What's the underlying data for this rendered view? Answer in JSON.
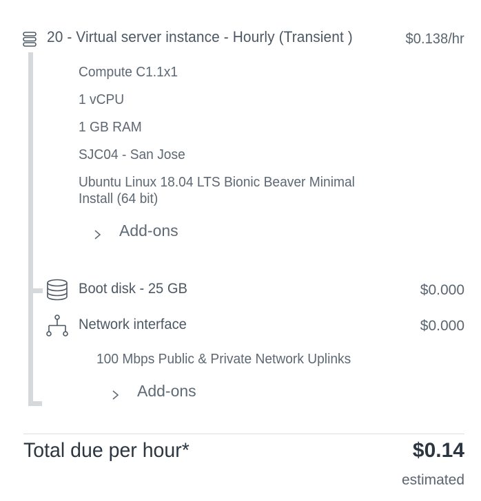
{
  "instance": {
    "title": "20 - Virtual server instance - Hourly (Transient )",
    "price": "$0.138/hr",
    "icon": "server-stack-icon",
    "specs": [
      "Compute C1.1x1",
      "1 vCPU",
      "1 GB RAM",
      "SJC04 - San Jose",
      "Ubuntu Linux 18.04 LTS Bionic Beaver Minimal Install (64 bit)"
    ],
    "addons_label": "Add-ons"
  },
  "boot_disk": {
    "title": "Boot disk - 25 GB",
    "price": "$0.000",
    "icon": "database-disk-icon"
  },
  "network": {
    "title": "Network interface",
    "price": "$0.000",
    "icon": "network-tree-icon",
    "detail": "100 Mbps Public & Private Network Uplinks",
    "addons_label": "Add-ons"
  },
  "total": {
    "label": "Total due per hour*",
    "value": "$0.14",
    "note": "estimated"
  }
}
